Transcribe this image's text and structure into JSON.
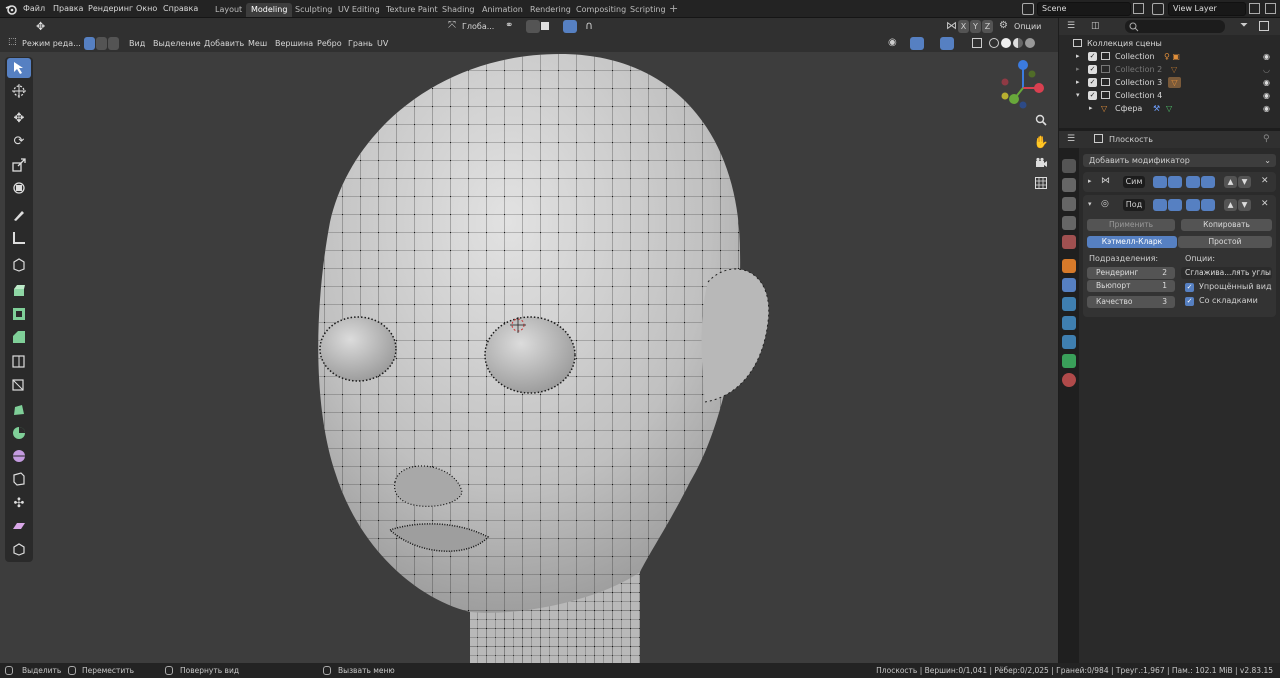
{
  "top_menu": [
    "Файл",
    "Правка",
    "Рендеринг",
    "Окно",
    "Справка"
  ],
  "workspaces": [
    "Layout",
    "Modeling",
    "Sculpting",
    "UV Editing",
    "Texture Paint",
    "Shading",
    "Animation",
    "Rendering",
    "Compositing",
    "Scripting"
  ],
  "active_workspace": "Modeling",
  "scene": {
    "name": "Scene",
    "view_layer": "View Layer"
  },
  "header": {
    "transform_orientation": "Глоба...",
    "options": "Опции",
    "axes": [
      "X",
      "Y",
      "Z"
    ],
    "mode": "Режим реда...",
    "menus": [
      "Вид",
      "Выделение",
      "Добавить",
      "Меш",
      "Вершина",
      "Ребро",
      "Грань",
      "UV"
    ]
  },
  "outliner": {
    "title": "Коллекция сцены",
    "items": [
      {
        "label": "Collection",
        "dim": false
      },
      {
        "label": "Collection 2",
        "dim": true
      },
      {
        "label": "Collection 3",
        "dim": false
      },
      {
        "label": "Collection 4",
        "dim": false
      },
      {
        "label": "Сфера",
        "dim": false
      }
    ]
  },
  "properties": {
    "object_name": "Плоскость",
    "add_modifier": "Добавить модификатор",
    "modifier1_name": "Сим",
    "modifier2_name": "Под",
    "apply": "Применить",
    "copy": "Копировать",
    "catmull": "Кэтмелл-Кларк",
    "simple": "Простой",
    "subdivisions_label": "Подразделения:",
    "options_label": "Опции:",
    "render_label": "Рендеринг",
    "render_value": "2",
    "viewport_label": "Вьюпорт",
    "viewport_value": "1",
    "quality_label": "Качество",
    "quality_value": "3",
    "smooth_dropdown": "Сглажива...лять углы",
    "simplified_view": "Упрощённый вид",
    "with_creases": "Со складками"
  },
  "statusbar": {
    "select": "Выделить",
    "move": "Переместить",
    "rotate": "Повернуть вид",
    "call_menu": "Вызвать меню",
    "stats": "Плоскость | Вершин:0/1,041 | Рёбер:0/2,025 | Граней:0/984 | Треуг.:1,967 | Пам.: 102.1 MiB | v2.83.15"
  },
  "colors": {
    "accent": "#5680c2",
    "viewport": "#3d3d3d",
    "mesh": "#c4c4c4"
  }
}
